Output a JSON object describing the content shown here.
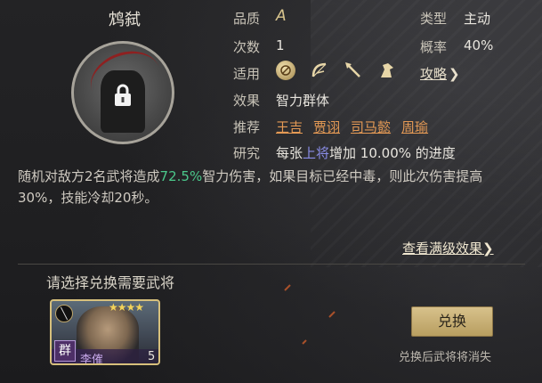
{
  "skill": {
    "name": "鸩弑",
    "quality_label": "品质",
    "quality_value": "A",
    "count_label": "次数",
    "count_value": "1",
    "type_label": "类型",
    "type_value": "主动",
    "rate_label": "概率",
    "rate_value": "40%",
    "applicable_label": "适用",
    "strategy_link": "攻略",
    "effect_label": "效果",
    "effect_value": "智力群体",
    "recommend_label": "推荐",
    "recommend_tags": [
      "王吉",
      "贾诩",
      "司马懿",
      "周瑜"
    ],
    "research_label": "研究",
    "research_pre": "每张",
    "research_highlight": "上将",
    "research_post": "增加 10.00% 的进度",
    "desc_part1": "随机对敌方2名武将造成",
    "desc_highlight": "72.5%",
    "desc_part2": "智力伤害，如果目标已经中毒，则此次伤害提高30%，技能冷却20秒。",
    "full_effect_link": "查看满级效果"
  },
  "exchange": {
    "prompt": "请选择兑换需要武将",
    "hero": {
      "faction": "群",
      "name": "李傕",
      "level": "5",
      "stars": "★★★★"
    },
    "button_label": "兑换",
    "note": "兑换后武将将消失"
  },
  "icons": [
    "shield-icon",
    "bow-icon",
    "spear-icon",
    "horse-icon",
    "lock-icon"
  ],
  "colors": {
    "highlight_green": "#4bc78a",
    "research_blue": "#8a8de8",
    "tag_orange": "#e59a55",
    "button_gold": "#d7c18b"
  }
}
